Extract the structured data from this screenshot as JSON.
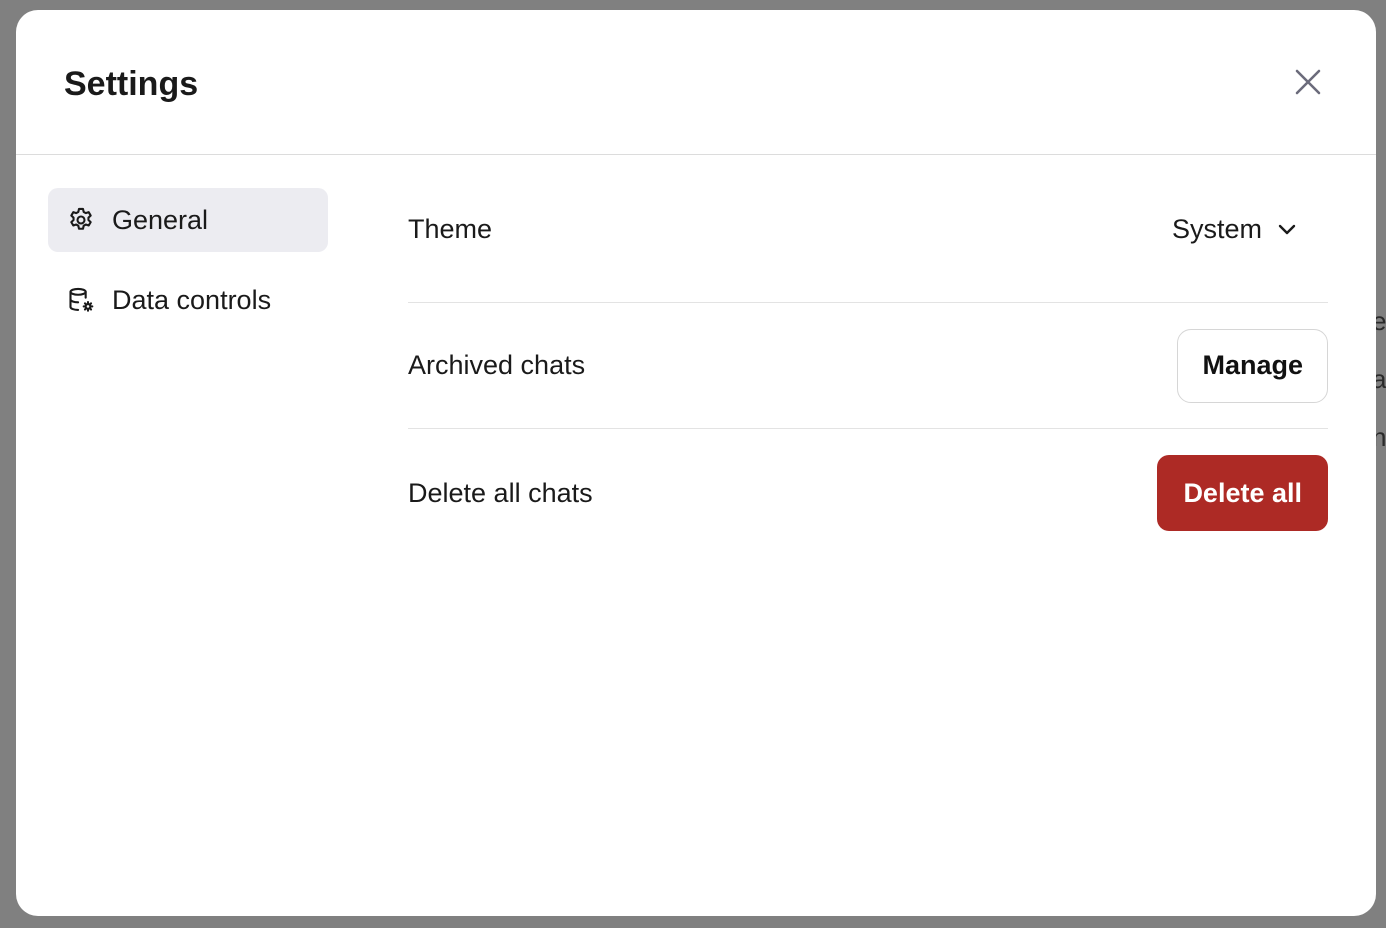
{
  "background": {
    "partial_text": [
      "e",
      "a",
      "n"
    ]
  },
  "modal": {
    "title": "Settings",
    "close_icon": "close-icon"
  },
  "sidebar": {
    "items": [
      {
        "label": "General",
        "icon": "gear-icon",
        "active": true
      },
      {
        "label": "Data controls",
        "icon": "database-settings-icon",
        "active": false
      }
    ]
  },
  "settings": {
    "theme": {
      "label": "Theme",
      "value": "System",
      "icon": "chevron-down-icon"
    },
    "archived": {
      "label": "Archived chats",
      "button": "Manage"
    },
    "delete": {
      "label": "Delete all chats",
      "button": "Delete all"
    }
  },
  "colors": {
    "overlay": "#808080",
    "active_item_bg": "#ececf1",
    "danger": "#ad2a25"
  }
}
